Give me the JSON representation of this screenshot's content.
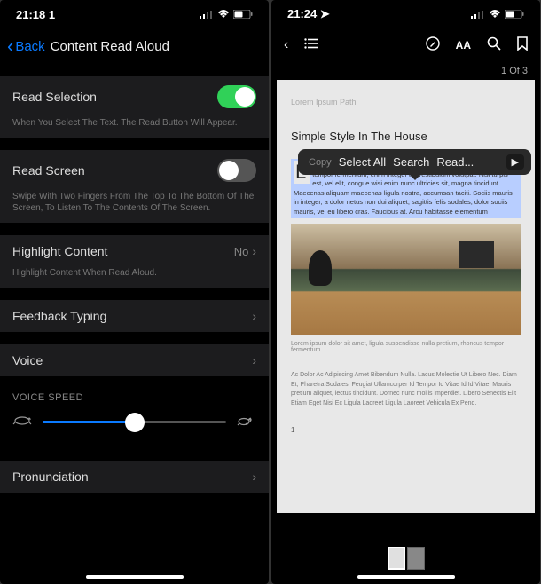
{
  "left": {
    "status": {
      "time": "21:18 1",
      "loc_icon": "▾"
    },
    "nav": {
      "back": "Back",
      "title": "Content Read Aloud"
    },
    "read_selection": {
      "label": "Read Selection",
      "desc": "When You Select The Text. The Read Button Will Appear."
    },
    "read_screen": {
      "label": "Read Screen",
      "desc": "Swipe With Two Fingers From The Top To The Bottom Of The Screen, To Listen To The Contents Of The Screen."
    },
    "highlight": {
      "label": "Highlight Content",
      "value": "No",
      "desc": "Highlight Content When Read Aloud."
    },
    "feedback": {
      "label": "Feedback Typing"
    },
    "voice": {
      "label": "Voice"
    },
    "speed": {
      "label": "VOICE SPEED"
    },
    "pron": {
      "label": "Pronunciation"
    }
  },
  "right": {
    "status": {
      "time": "21:24"
    },
    "page_indicator": "1 Of 3",
    "doc": {
      "breadcrumb": "Lorem Ipsum Path",
      "title": "Simple Style In The House",
      "dropcap": "L",
      "para": "orem ipsum dolor sit amet, ligula suspendisse nulla pretium, rhoncus tempor fermentum, enim integer ad vestibulum volutpat. Nisl turpis est, vel elit, congue wisi enim nunc ultricies sit, magna tincidunt. Maecenas aliquam maecenas ligula nostra, accumsan taciti. Sociis mauris in integer, a dolor netus non dui aliquet, sagittis felis sodales, dolor sociis mauris, vel eu libero cras. Faucibus at. Arcu habitasse elementum",
      "caption": "Lorem ipsum dolor sit amet, ligula suspendisse nulla pretium, rhoncus tempor fermentum.",
      "footer": "Ac Dolor Ac Adipiscing Amet Bibendum Nulla. Lacus Molestie Ut Libero Nec. Diam Et, Pharetra Sodales, Feugiat Ullamcorper Id Tempor Id Vitae Id Id Vitae. Mauris pretium aliquet, lectus tincidunt. Dornec nunc mollis imperdiet. Libero Senectis Elit Etiam Eget Nisi Ec Ligula Laoreet Ligula Laoreet Vehicula Ex Pend.",
      "page_num": "1"
    },
    "context_menu": {
      "copy": "Copy",
      "select_all": "Select All",
      "search": "Search",
      "read": "Read..."
    }
  }
}
